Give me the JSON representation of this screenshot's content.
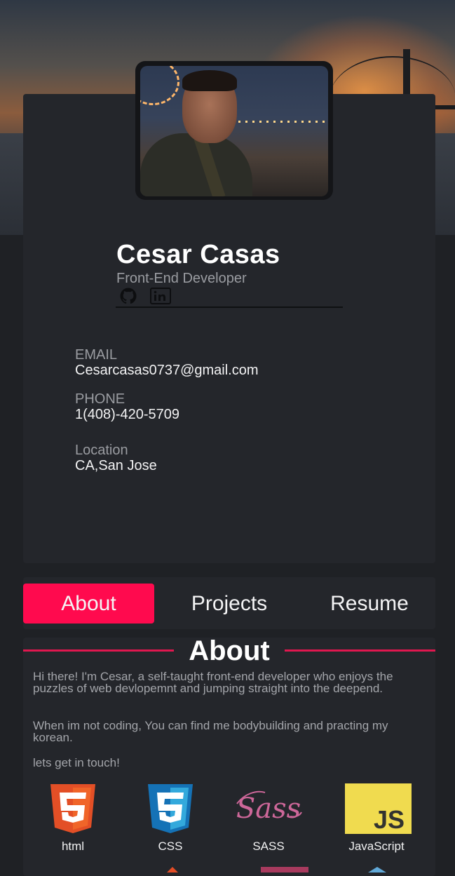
{
  "profile": {
    "name": "Cesar Casas",
    "role": "Front-End Developer",
    "socials": [
      "github-icon",
      "linkedin-icon"
    ]
  },
  "contact": {
    "email_label": "EMAIL",
    "email_value": "Cesarcasas0737@gmail.com",
    "phone_label": "PHONE",
    "phone_value": "1(408)-420-5709",
    "location_label": "Location",
    "location_value": "CA,San Jose"
  },
  "tabs": [
    {
      "label": "About",
      "active": true
    },
    {
      "label": "Projects",
      "active": false
    },
    {
      "label": "Resume",
      "active": false
    }
  ],
  "about": {
    "heading": "About",
    "para1": "Hi there! I'm Cesar, a self-taught front-end developer who enjoys the puzzles of web devlopemnt and jumping straight into the deepend.",
    "para2": "When im not coding, You can find me bodybuilding and practing my korean.",
    "para3": "lets get in touch!",
    "skills": [
      {
        "label": "html",
        "icon": "html5-icon"
      },
      {
        "label": "CSS",
        "icon": "css3-icon"
      },
      {
        "label": "SASS",
        "icon": "sass-icon"
      },
      {
        "label": "JavaScript",
        "icon": "javascript-icon"
      }
    ]
  },
  "colors": {
    "accent": "#ff0a4e",
    "card": "#24262b",
    "background": "#1f2125"
  }
}
